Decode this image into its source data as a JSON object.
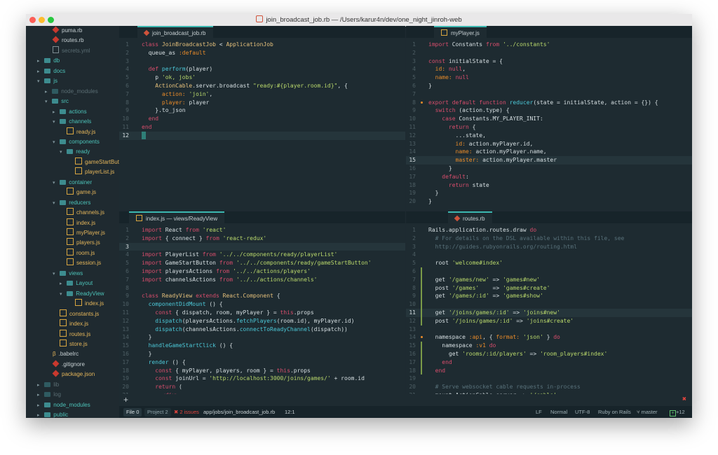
{
  "window": {
    "title": "join_broadcast_job.rb — /Users/karur4n/dev/one_night_jinroh-web"
  },
  "sidebar": {
    "items": [
      {
        "label": "puma.rb",
        "icon": "ruby-file-icon",
        "indent": 38,
        "kind": "rb",
        "style": "light"
      },
      {
        "label": "routes.rb",
        "icon": "ruby-file-icon",
        "indent": 38,
        "kind": "rb",
        "style": "light"
      },
      {
        "label": "secrets.yml",
        "icon": "text-file-icon",
        "indent": 38,
        "kind": "txt",
        "style": "dim"
      },
      {
        "label": "db",
        "icon": "folder-icon",
        "indent": 16,
        "kind": "folder",
        "arrow": "▸",
        "style": "teal"
      },
      {
        "label": "docs",
        "icon": "folder-icon",
        "indent": 16,
        "kind": "folder",
        "arrow": "▸",
        "style": "teal"
      },
      {
        "label": "js",
        "icon": "folder-icon",
        "indent": 16,
        "kind": "folder",
        "arrow": "▾",
        "style": "teal"
      },
      {
        "label": "node_modules",
        "icon": "folder-icon",
        "indent": 27,
        "kind": "folderdim",
        "arrow": "▸",
        "style": "dim"
      },
      {
        "label": "src",
        "icon": "folder-icon",
        "indent": 27,
        "kind": "folder",
        "arrow": "▾",
        "style": "teal"
      },
      {
        "label": "actions",
        "icon": "folder-icon",
        "indent": 38,
        "kind": "folder",
        "arrow": "▸",
        "style": "teal"
      },
      {
        "label": "channels",
        "icon": "folder-icon",
        "indent": 38,
        "kind": "folder",
        "arrow": "▾",
        "style": "teal"
      },
      {
        "label": "ready.js",
        "icon": "js-file-icon",
        "indent": 58,
        "kind": "js",
        "style": "gold"
      },
      {
        "label": "components",
        "icon": "folder-icon",
        "indent": 38,
        "kind": "folder",
        "arrow": "▾",
        "style": "teal"
      },
      {
        "label": "ready",
        "icon": "folder-icon",
        "indent": 48,
        "kind": "folder",
        "arrow": "▾",
        "style": "teal"
      },
      {
        "label": "gameStartBut",
        "icon": "js-file-icon",
        "indent": 70,
        "kind": "js",
        "style": "gold"
      },
      {
        "label": "playerList.js",
        "icon": "js-file-icon",
        "indent": 70,
        "kind": "js",
        "style": "gold"
      },
      {
        "label": "container",
        "icon": "folder-icon",
        "indent": 38,
        "kind": "folder",
        "arrow": "▾",
        "style": "teal"
      },
      {
        "label": "game.js",
        "icon": "js-file-icon",
        "indent": 58,
        "kind": "js",
        "style": "gold"
      },
      {
        "label": "reducers",
        "icon": "folder-icon",
        "indent": 38,
        "kind": "folder",
        "arrow": "▾",
        "style": "teal"
      },
      {
        "label": "channels.js",
        "icon": "js-file-icon",
        "indent": 58,
        "kind": "js",
        "style": "gold"
      },
      {
        "label": "index.js",
        "icon": "js-file-icon",
        "indent": 58,
        "kind": "js",
        "style": "gold"
      },
      {
        "label": "myPlayer.js",
        "icon": "js-file-icon",
        "indent": 58,
        "kind": "js",
        "style": "gold"
      },
      {
        "label": "players.js",
        "icon": "js-file-icon",
        "indent": 58,
        "kind": "js",
        "style": "gold"
      },
      {
        "label": "room.js",
        "icon": "js-file-icon",
        "indent": 58,
        "kind": "js",
        "style": "gold"
      },
      {
        "label": "session.js",
        "icon": "js-file-icon",
        "indent": 58,
        "kind": "js",
        "style": "gold"
      },
      {
        "label": "views",
        "icon": "folder-icon",
        "indent": 38,
        "kind": "folder",
        "arrow": "▾",
        "style": "teal"
      },
      {
        "label": "Layout",
        "icon": "folder-icon",
        "indent": 48,
        "kind": "folder",
        "arrow": "▸",
        "style": "teal"
      },
      {
        "label": "ReadyView",
        "icon": "folder-icon",
        "indent": 48,
        "kind": "folder",
        "arrow": "▾",
        "style": "teal"
      },
      {
        "label": "index.js",
        "icon": "js-file-icon",
        "indent": 70,
        "kind": "js",
        "style": "gold"
      },
      {
        "label": "constants.js",
        "icon": "js-file-icon",
        "indent": 48,
        "kind": "js",
        "style": "gold"
      },
      {
        "label": "index.js",
        "icon": "js-file-icon",
        "indent": 48,
        "kind": "js",
        "style": "gold"
      },
      {
        "label": "routes.js",
        "icon": "js-file-icon",
        "indent": 48,
        "kind": "js",
        "style": "gold"
      },
      {
        "label": "store.js",
        "icon": "js-file-icon",
        "indent": 48,
        "kind": "js",
        "style": "gold"
      },
      {
        "label": ".babelrc",
        "icon": "babel-file-icon",
        "indent": 38,
        "kind": "babel",
        "style": "light"
      },
      {
        "label": ".gitignore",
        "icon": "git-icon",
        "indent": 38,
        "kind": "rb",
        "style": "light"
      },
      {
        "label": "package.json",
        "icon": "npm-file-icon",
        "indent": 38,
        "kind": "rb",
        "style": "gold"
      },
      {
        "label": "lib",
        "icon": "folder-icon",
        "indent": 16,
        "kind": "folderdim",
        "arrow": "▸",
        "style": "dim"
      },
      {
        "label": "log",
        "icon": "folder-icon",
        "indent": 16,
        "kind": "folderdim",
        "arrow": "▸",
        "style": "dim"
      },
      {
        "label": "node_modules",
        "icon": "folder-icon",
        "indent": 16,
        "kind": "folder",
        "arrow": "▸",
        "style": "teal"
      },
      {
        "label": "public",
        "icon": "folder-icon",
        "indent": 16,
        "kind": "folder",
        "arrow": "▸",
        "style": "teal"
      }
    ]
  },
  "panes": {
    "top_left": {
      "tab": "join_broadcast_job.rb",
      "lines": [
        {
          "n": "1",
          "h": "<span class='k'>class</span> <span class='y'>JoinBroadcastJob</span> &lt; <span class='y'>ApplicationJob</span>"
        },
        {
          "n": "2",
          "h": "  queue_as <span class='o'>:default</span>"
        },
        {
          "n": "3",
          "h": ""
        },
        {
          "n": "4",
          "h": "  <span class='k'>def</span> <span class='f'>perform</span>(player)"
        },
        {
          "n": "5",
          "h": "    p <span class='s'>'ok, jobs'</span>"
        },
        {
          "n": "6",
          "h": "    <span class='y'>ActionCable</span>.server.broadcast <span class='s'>\"ready:#{player.room.id}\"</span>, {"
        },
        {
          "n": "7",
          "h": "      <span class='o'>action:</span> <span class='s'>'join'</span>,"
        },
        {
          "n": "8",
          "h": "      <span class='o'>player:</span> player"
        },
        {
          "n": "9",
          "h": "    }.to_json"
        },
        {
          "n": "10",
          "h": "  <span class='k'>end</span>"
        },
        {
          "n": "11",
          "h": "<span class='k'>end</span>"
        },
        {
          "n": "12",
          "h": "<span class='caret'></span>",
          "cur": true
        }
      ]
    },
    "top_right": {
      "tab": "myPlayer.js",
      "lines": [
        {
          "n": "1",
          "h": "<span class='k'>import</span> Constants <span class='k'>from</span> <span class='s'>'../constants'</span>"
        },
        {
          "n": "2",
          "h": ""
        },
        {
          "n": "3",
          "h": "<span class='k'>const</span> initialState = {"
        },
        {
          "n": "4",
          "h": "  <span class='o'>id:</span> <span class='k'>null</span>,"
        },
        {
          "n": "5",
          "h": "  <span class='o'>name:</span> <span class='k'>null</span>"
        },
        {
          "n": "6",
          "h": "}"
        },
        {
          "n": "7",
          "h": ""
        },
        {
          "n": "8",
          "h": "<span class='k'>export default function</span> <span class='f'>reducer</span>(state = initialState, action = {}) {",
          "dot": true
        },
        {
          "n": "9",
          "h": "  <span class='k'>switch</span> (action.type) {"
        },
        {
          "n": "10",
          "h": "    <span class='k'>case</span> Constants.MY_PLAYER_INIT:"
        },
        {
          "n": "11",
          "h": "      <span class='k'>return</span> {"
        },
        {
          "n": "12",
          "h": "        ...state,"
        },
        {
          "n": "13",
          "h": "        <span class='o'>id:</span> action.myPlayer.id,"
        },
        {
          "n": "14",
          "h": "        <span class='o'>name:</span> action.myPlayer.name,"
        },
        {
          "n": "15",
          "h": "        <span class='o'>master:</span> action.myPlayer.master",
          "cur": true
        },
        {
          "n": "16",
          "h": "      }"
        },
        {
          "n": "17",
          "h": "    <span class='k'>default</span>:"
        },
        {
          "n": "18",
          "h": "      <span class='k'>return</span> state"
        },
        {
          "n": "19",
          "h": "  }"
        },
        {
          "n": "20",
          "h": "}"
        }
      ]
    },
    "bottom_left": {
      "tab": "index.js — views/ReadyView",
      "lines": [
        {
          "n": "1",
          "h": "<span class='k'>import</span> React <span class='k'>from</span> <span class='s'>'react'</span>"
        },
        {
          "n": "2",
          "h": "<span class='k'>import</span> { connect } <span class='k'>from</span> <span class='s'>'react-redux'</span>"
        },
        {
          "n": "3",
          "h": "",
          "cur": true
        },
        {
          "n": "4",
          "h": "<span class='k'>import</span> PlayerList <span class='k'>from</span> <span class='s'>'../../components/ready/playerList'</span>"
        },
        {
          "n": "5",
          "h": "<span class='k'>import</span> GameStartButton <span class='k'>from</span> <span class='s'>'../../components/ready/gameStartButton'</span>"
        },
        {
          "n": "6",
          "h": "<span class='k'>import</span> playersActions <span class='k'>from</span> <span class='s'>'../../actions/players'</span>"
        },
        {
          "n": "7",
          "h": "<span class='k'>import</span> channelsActions <span class='k'>from</span> <span class='s'>'../../actions/channels'</span>"
        },
        {
          "n": "8",
          "h": ""
        },
        {
          "n": "9",
          "h": "<span class='k'>class</span> <span class='y'>ReadyView</span> <span class='k'>extends</span> <span class='y'>React.Component</span> {"
        },
        {
          "n": "10",
          "h": "  <span class='f'>componentDidMount</span> () {"
        },
        {
          "n": "11",
          "h": "    <span class='k'>const</span> { dispatch, room, myPlayer } = <span class='k'>this</span>.props"
        },
        {
          "n": "12",
          "h": "    <span class='f'>dispatch</span>(playersActions.<span class='f'>fetchPlayers</span>(room.id), myPlayer.id)"
        },
        {
          "n": "13",
          "h": "    <span class='f'>dispatch</span>(channelsActions.<span class='f'>connectToReadyChannel</span>(dispatch))"
        },
        {
          "n": "14",
          "h": "  }"
        },
        {
          "n": "15",
          "h": "  <span class='f'>handleGameStartClick</span> () {"
        },
        {
          "n": "16",
          "h": "  }"
        },
        {
          "n": "17",
          "h": "  <span class='f'>render</span> () {"
        },
        {
          "n": "18",
          "h": "    <span class='k'>const</span> { myPlayer, players, room } = <span class='k'>this</span>.props"
        },
        {
          "n": "19",
          "h": "    <span class='k'>const</span> joinUrl = <span class='s'>'http://localhost:3000/joins/games/'</span> + room.id"
        },
        {
          "n": "20",
          "h": "    <span class='k'>return</span> ("
        },
        {
          "n": "21",
          "h": "      <span class='k'>&lt;div&gt;</span>"
        }
      ]
    },
    "bottom_right": {
      "tab": "routes.rb",
      "lines": [
        {
          "n": "1",
          "h": "Rails.application.routes.draw <span class='k'>do</span>"
        },
        {
          "n": "2",
          "h": "  <span class='c'># For details on the DSL available within this file, see</span>"
        },
        {
          "n": "3",
          "h": "  <span class='c'>http://guides.rubyonrails.org/routing.html</span>"
        },
        {
          "n": "4",
          "h": ""
        },
        {
          "n": "5",
          "h": "  root <span class='s'>'welcome#index'</span>"
        },
        {
          "n": "6",
          "h": "",
          "mod": true
        },
        {
          "n": "7",
          "h": "  get <span class='s'>'/games/new'</span> =&gt; <span class='s'>'games#new'</span>",
          "mod": true
        },
        {
          "n": "8",
          "h": "  post <span class='s'>'/games'</span>    =&gt; <span class='s'>'games#create'</span>",
          "mod": true
        },
        {
          "n": "9",
          "h": "  get <span class='s'>'/games/:id'</span> =&gt; <span class='s'>'games#show'</span>",
          "mod": true
        },
        {
          "n": "10",
          "h": "",
          "mod": true
        },
        {
          "n": "11",
          "h": "  get <span class='s'>'/joins/games/:id'</span> =&gt; <span class='s'>'joins#new'</span>",
          "cur": true,
          "mod": true
        },
        {
          "n": "12",
          "h": "  post <span class='s'>'/joins/games/:id'</span> =&gt; <span class='s'>'joins#create'</span>",
          "mod": true
        },
        {
          "n": "13",
          "h": ""
        },
        {
          "n": "14",
          "h": "  namespace <span class='o'>:api</span>, { <span class='o'>format:</span> <span class='s'>'json'</span> } <span class='k'>do</span>",
          "dot": true
        },
        {
          "n": "15",
          "h": "    namespace <span class='o'>:v1</span> <span class='k'>do</span>",
          "mod": true
        },
        {
          "n": "16",
          "h": "      get <span class='s'>'rooms/:id/players'</span> =&gt; <span class='s'>'room_players#index'</span>",
          "mod": true
        },
        {
          "n": "17",
          "h": "    <span class='k'>end</span>",
          "mod": true
        },
        {
          "n": "18",
          "h": "  <span class='k'>end</span>",
          "mod": true
        },
        {
          "n": "19",
          "h": ""
        },
        {
          "n": "20",
          "h": "  <span class='c'># Serve websocket cable requests in-process</span>"
        },
        {
          "n": "21",
          "h": "  mount ActionCable.server =&gt; <span class='s'>'/cable'</span>"
        }
      ]
    }
  },
  "bottom_plus": "+",
  "status": {
    "file_tab": "File",
    "file_count": "0",
    "project_tab": "Project",
    "project_count": "2",
    "issues": "2 issues",
    "path": "app/jobs/join_broadcast_job.rb",
    "cursor": "12:1",
    "line_ending": "LF",
    "mode": "Normal",
    "encoding": "UTF-8",
    "grammar": "Ruby on Rails",
    "branch": "master",
    "git_changes": "+12"
  },
  "colors": {
    "accent": "#3bb7b0",
    "error": "#e0443e",
    "keyword": "#d84d6c",
    "string": "#b9d86b"
  }
}
